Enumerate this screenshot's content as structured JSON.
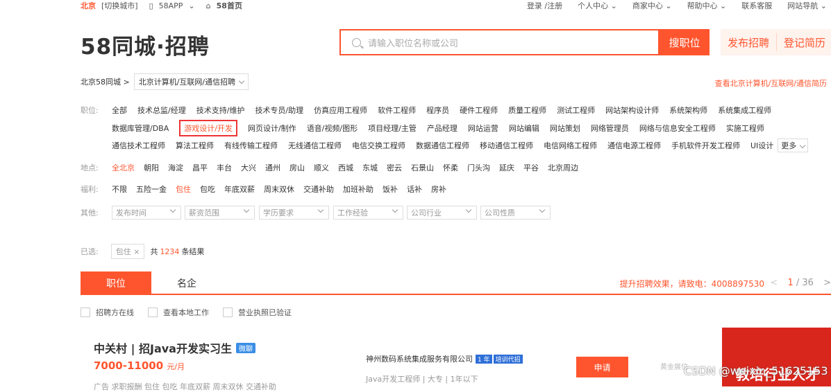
{
  "topbar": {
    "city": "北京",
    "switch_city": "[切换城市]",
    "app": "58APP",
    "home": "58首页",
    "login": "登录 /注册",
    "personal": "个人中心",
    "merchant": "商家中心",
    "help": "帮助中心",
    "service": "联系客服",
    "sitenav": "网站导航"
  },
  "logo": {
    "text": "58同城·招聘"
  },
  "search": {
    "placeholder": "请输入职位名称或公司",
    "button": "搜职位",
    "publish": "发布招聘",
    "resume": "登记简历"
  },
  "crumb": {
    "home": "北京58同城 >",
    "current": "北京计算机/互联网/通信招聘",
    "view_all": "查看北京计算机/互联网/通信简历"
  },
  "filters": {
    "job_label": "职位:",
    "job_rows": [
      [
        "全部",
        "技术总监/经理",
        "技术支持/维护",
        "技术专员/助理",
        "仿真应用工程师",
        "软件工程师",
        "程序员",
        "硬件工程师",
        "质量工程师",
        "测试工程师",
        "网站架构设计师",
        "系统架构师",
        "系统集成工程师"
      ],
      [
        "数据库管理/DBA",
        "游戏设计/开发",
        "网页设计/制作",
        "语音/视频/图形",
        "项目经理/主管",
        "产品经理",
        "网站运营",
        "网站编辑",
        "网站策划",
        "网络管理员",
        "网络与信息安全工程师",
        "实施工程师"
      ],
      [
        "通信技术工程师",
        "算法工程师",
        "有线传输工程师",
        "无线通信工程师",
        "电信交换工程师",
        "数据通信工程师",
        "移动通信工程师",
        "电信网络工程师",
        "通信电源工程师",
        "手机软件开发工程师",
        "UI设计"
      ]
    ],
    "more": "更多",
    "loc_label": "地点:",
    "locations": [
      "全北京",
      "朝阳",
      "海淀",
      "昌平",
      "丰台",
      "大兴",
      "通州",
      "房山",
      "顺义",
      "西城",
      "东城",
      "密云",
      "石景山",
      "怀柔",
      "门头沟",
      "延庆",
      "平谷",
      "北京周边"
    ],
    "welfare_label": "福利:",
    "welfare": [
      "不限",
      "五险一金",
      "包住",
      "包吃",
      "年底双薪",
      "周末双休",
      "交通补助",
      "加班补助",
      "饭补",
      "话补",
      "房补"
    ],
    "other_label": "其他:",
    "others": [
      "发布时间",
      "薪资范围",
      "学历要求",
      "工作经验",
      "公司行业",
      "公司性质"
    ]
  },
  "chosen": {
    "label": "已选:",
    "tag": "包住 ×",
    "prefix": "共",
    "count": "1234",
    "suffix": "条结果"
  },
  "tabs": {
    "job": "职位",
    "company": "名企",
    "hotline": "提升招聘效果，请致电：4008897530",
    "page_cur": "1",
    "page_total": "/ 36",
    "prev": "<",
    "next": ">"
  },
  "checks": [
    "招聘方在线",
    "查看本地工作",
    "营业执照已验证"
  ],
  "job": {
    "title": "中关村 | 招Java开发实习生",
    "wx": "微聊",
    "salary": "7000-11000",
    "unit": "元/月",
    "benefits": "广告  求职报酬  包住  包吃  年底双薪  周末双休  交通补助",
    "company": "神州数码系统集成服务有限公司",
    "years": "1 年",
    "train": "培训代招",
    "info": "Java开发工程师 | 大专 | 1年以下",
    "apply": "申请",
    "gold": "黄金展位"
  },
  "ad": {
    "text": "教培行业人才"
  },
  "watermark": "CSDN @weixin_51625153"
}
